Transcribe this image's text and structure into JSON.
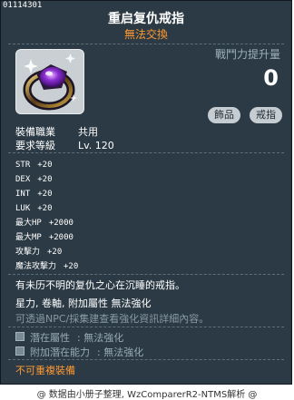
{
  "item_id": "01114301",
  "title": "重启复仇戒指",
  "subtitle": "無法交換",
  "power": {
    "label": "戰鬥力提升量",
    "value": "0"
  },
  "tags": [
    "飾品",
    "戒指"
  ],
  "requirements": [
    {
      "label": "裝備職業",
      "value": "共用"
    },
    {
      "label": "要求等級",
      "value": "Lv. 120"
    }
  ],
  "stats": [
    {
      "name": "STR",
      "value": "+20"
    },
    {
      "name": "DEX",
      "value": "+20"
    },
    {
      "name": "INT",
      "value": "+20"
    },
    {
      "name": "LUK",
      "value": "+20"
    },
    {
      "name": "最大HP",
      "value": "+2000"
    },
    {
      "name": "最大MP",
      "value": "+2000"
    },
    {
      "name": "攻擊力",
      "value": "+20"
    },
    {
      "name": "魔法攻擊力",
      "value": "+20"
    }
  ],
  "description": "有未历不明的复仇之心在沉睡的戒指。",
  "properties": "星力, 卷軸, 附加屬性 無法強化",
  "note": "可透過NPC/採集建查看強化資訊詳細內容。",
  "potentials": [
    {
      "label": "潛在屬性",
      "value": ": 無法強化"
    },
    {
      "label": "附加潛在能力",
      "value": ": 無法強化"
    }
  ],
  "warning": "不可重複裝備",
  "footer": "@ 数据由小册子整理, WzComparerR2-NTMS解析 @",
  "colors": {
    "panel_bg": "#2b3a44",
    "accent_orange": "#ff9933",
    "text_white": "#ffffff",
    "muted": "#8a9aa4"
  },
  "icon": "purple-gem-ring-icon"
}
